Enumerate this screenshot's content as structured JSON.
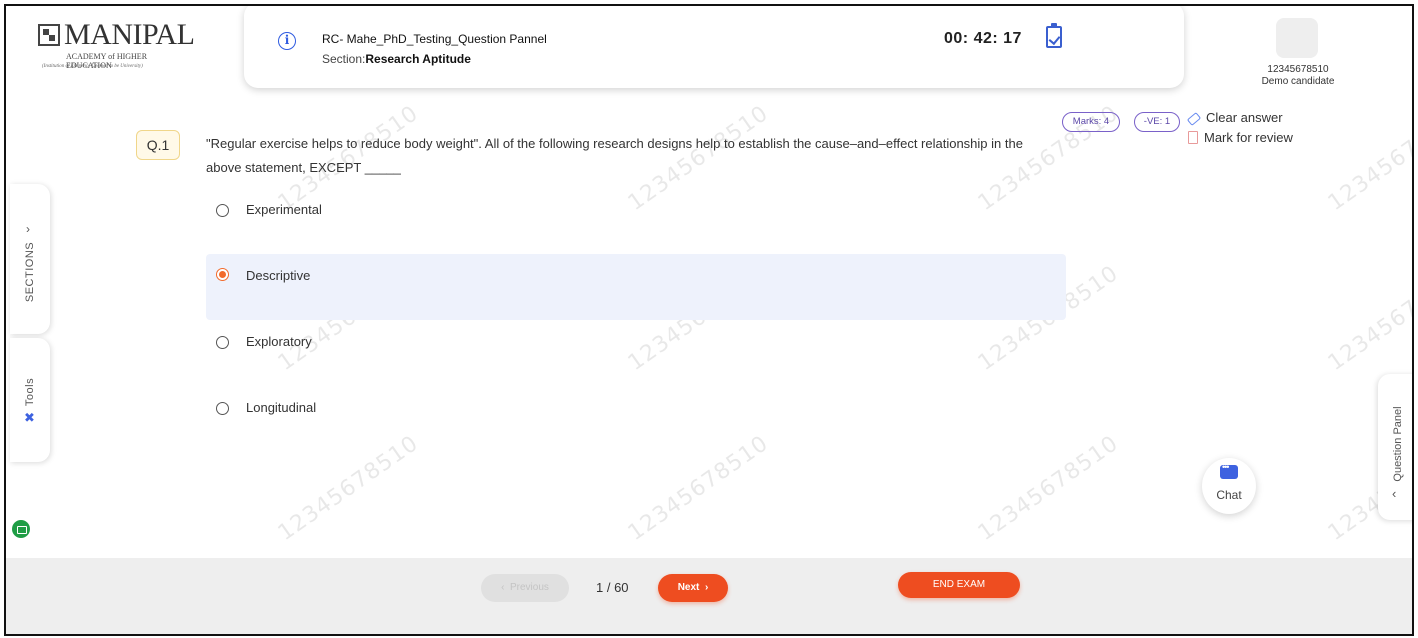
{
  "logo": {
    "name": "MANIPAL",
    "subtitle": "ACADEMY of HIGHER EDUCATION",
    "tagline": "(Institution of Eminence Deemed to be University)"
  },
  "header": {
    "exam_title": "RC- Mahe_PhD_Testing_Question Pannel",
    "section_prefix": "Section:",
    "section_name": "Research Aptitude",
    "timer": "00: 42: 17"
  },
  "candidate": {
    "id": "12345678510",
    "name": "Demo candidate"
  },
  "watermark": "12345678510",
  "side_tabs": {
    "sections": "SECTIONS",
    "tools": "Tools",
    "question_panel": "Question Panel"
  },
  "question": {
    "number": "Q.1",
    "text": "\"Regular exercise helps to reduce body weight\". All of the following research designs help to establish the cause–and–effect relationship in the above statement, EXCEPT _____",
    "marks": "Marks: 4",
    "negative": "-VE: 1",
    "clear_answer": "Clear answer",
    "mark_review": "Mark for review",
    "options": [
      {
        "label": "Experimental",
        "selected": false
      },
      {
        "label": "Descriptive",
        "selected": true
      },
      {
        "label": "Exploratory",
        "selected": false
      },
      {
        "label": "Longitudinal",
        "selected": false
      }
    ]
  },
  "chat": {
    "label": "Chat"
  },
  "footer": {
    "previous": "Previous",
    "page": "1 / 60",
    "next": "Next",
    "end_exam": "END EXAM"
  },
  "colors": {
    "accent": "#ee4d20",
    "primary_blue": "#3e62e0",
    "selected_bg": "#eef2fc"
  }
}
